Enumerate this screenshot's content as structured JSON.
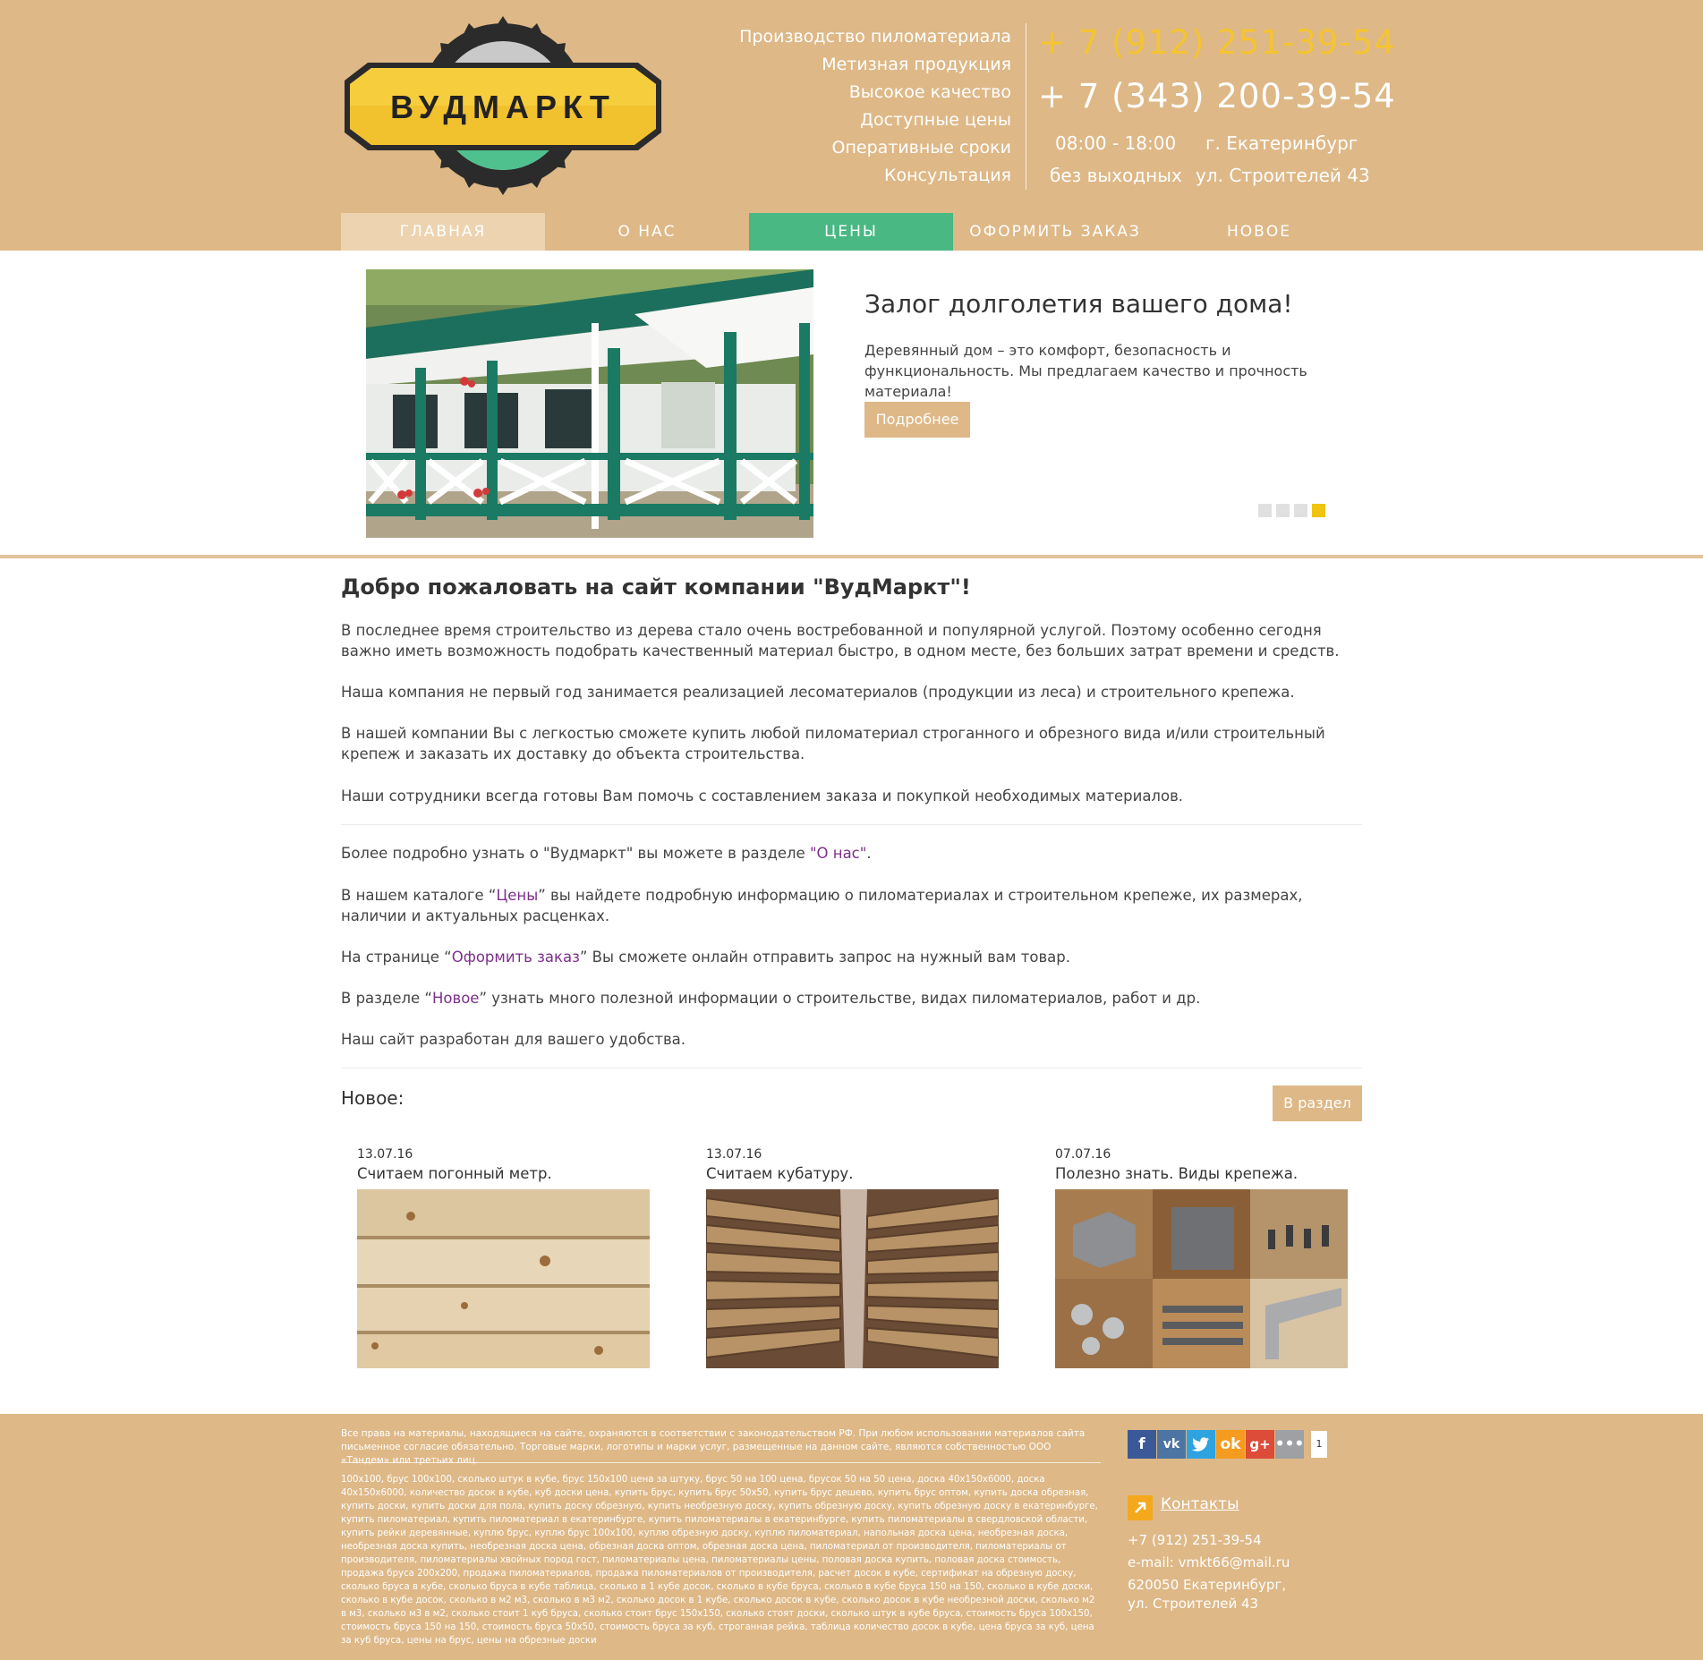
{
  "brand": {
    "logo_text": "ВУДМАРКТ",
    "colors": {
      "header_bg": "#deb887",
      "accent_yellow": "#f4c431",
      "accent_green": "#49b883",
      "link": "#7d2f8a"
    }
  },
  "header": {
    "slogans": [
      "Производство пиломатериала",
      "Метизная продукция",
      "Высокое качество",
      "Доступные цены",
      "Оперативные сроки",
      "Консультация"
    ],
    "phone_1": "+ 7 (912) 251-39-54",
    "phone_2": "+ 7 (343) 200-39-54",
    "hours": "08:00 - 18:00",
    "days": "без выходных",
    "city": "г. Екатеринбург",
    "street": "ул. Строителей 43"
  },
  "nav": [
    {
      "label": "ГЛАВНАЯ"
    },
    {
      "label": "О НАС"
    },
    {
      "label": "ЦЕНЫ"
    },
    {
      "label": "ОФОРМИТЬ ЗАКАЗ"
    },
    {
      "label": "НОВОЕ"
    }
  ],
  "slider": {
    "title": "Залог долголетия вашего дома!",
    "text": "Деревянный дом – это комфорт, безопасность и функциональность. Мы предлагаем качество и прочность материала!",
    "button": "Подробнее",
    "active_slide_index": 3,
    "slide_count": 4
  },
  "content": {
    "title": "Добро пожаловать на сайт компании \"ВудМаркт\"!",
    "p1": "В последнее время строительство из дерева стало очень востребованной и популярной услугой. Поэтому особенно сегодня важно иметь возможность подобрать качественный материал быстро, в одном месте, без больших затрат времени и средств.",
    "p2": "Наша компания не первый год занимается реализацией лесоматериалов (продукции из леса) и строительного крепежа.",
    "p3": "В нашей компании Вы с легкостью сможете купить любой пиломатериал строганного и обрезного вида и/или строительный крепеж и заказать их доставку до объекта строительства.",
    "p4": "Наши сотрудники всегда готовы Вам помочь с составлением заказа и покупкой необходимых материалов.",
    "l1_before": "Более подробно узнать о \"Вудмаркт\" вы можете в разделе ",
    "l1_link": "\"О нас\"",
    "l1_after": ".",
    "l2_before": "В нашем каталоге “",
    "l2_link": "Цены",
    "l2_after": "” вы найдете подробную информацию о пиломатериалах и строительном крепеже, их размерах, наличии и актуальных расценках.",
    "l3_before": "На странице “",
    "l3_link": "Оформить заказ",
    "l3_after": "” Вы сможете онлайн отправить запрос на нужный вам товар.",
    "l4_before": "В разделе “",
    "l4_link": "Новое",
    "l4_after": "” узнать много полезной информации о строительстве, видах пиломатериалов, работ и др.",
    "l5": "Наш сайт разработан для вашего удобства."
  },
  "news": {
    "label": "Новое:",
    "button": "В раздел",
    "items": [
      {
        "date": "13.07.16",
        "title": "Считаем погонный метр."
      },
      {
        "date": "13.07.16",
        "title": "Считаем кубатуру."
      },
      {
        "date": "07.07.16",
        "title": "Полезно знать. Виды крепежа."
      }
    ]
  },
  "footer": {
    "legal": "Все права на материалы, находящиеся на сайте, охраняются в соответствии с законодательством РФ. При любом использовании материалов сайта письменное согласие обязательно. Торговые марки, логотипы и марки услуг, размещенные на данном сайте, являются собственностью ООО «Тандем» или третьих лиц.",
    "keywords": "100х100, брус 100х100, сколько штук в кубе, брус 150х100 цена за штуку, брус 50 на 100 цена, брусок 50 на 50 цена, доска 40х150х6000, доска 40х150х6000, количество досок в кубе, куб доски цена, купить брус, купить брус 50х50, купить брус дешево, купить брус оптом, купить доска обрезная, купить доски, купить доски для пола, купить доску обрезную, купить необрезную доску, купить обрезную доску, купить обрезную доску в екатеринбурге, купить пиломатериал, купить пиломатериал в екатеринбурге, купить пиломатериалы в екатеринбурге, купить пиломатериалы в свердловской области, купить рейки деревянные, куплю брус, куплю брус 100х100, куплю обрезную доску, куплю пиломатериал, напольная доска цена, необрезная доска, необрезная доска купить, необрезная доска цена, обрезная доска оптом, обрезная доска цена, пиломатериал от производителя, пиломатериалы от производителя, пиломатериалы хвойных пород гост, пиломатериалы цена, пиломатериалы цены, половая доска купить, половая доска стоимость, продажа бруса 200х200, продажа пиломатериалов, продажа пиломатериалов от производителя, расчет досок в кубе, сертификат на обрезную доску, сколько бруса в кубе, сколько бруса в кубе таблица, сколько в 1 кубе досок, сколько в кубе бруса, сколько в кубе бруса 150 на 150, сколько в кубе доски, сколько в кубе досок, сколько в м2 м3, сколько в м3 м2, сколько досок в 1 кубе, сколько досок в кубе, сколько досок в кубе необрезной доски, сколько м2 в м3, сколько м3 в м2, сколько стоит 1 куб бруса, сколько стоит брус 150х150, сколько стоят доски, сколько штук в кубе бруса, стоимость бруса 100х150, стоимость бруса 150 на 150, стоимость бруса 50х50, стоимость бруса за куб, строганная рейка, таблица количество досок в кубе, цена бруса за куб, цена за куб бруса, цены на брус, цены на обрезные доски",
    "share_count": "1",
    "contacts_label": "Контакты",
    "phone": "+7 (912) 251-39-54",
    "email": "e-mail: vmkt66@mail.ru",
    "address_1": "620050 Екатеринбург,",
    "address_2": "ул. Строителей 43",
    "share_icons": [
      "facebook-icon",
      "vk-icon",
      "twitter-icon",
      "odnoklassniki-icon",
      "google-plus-icon",
      "more-icon"
    ]
  }
}
